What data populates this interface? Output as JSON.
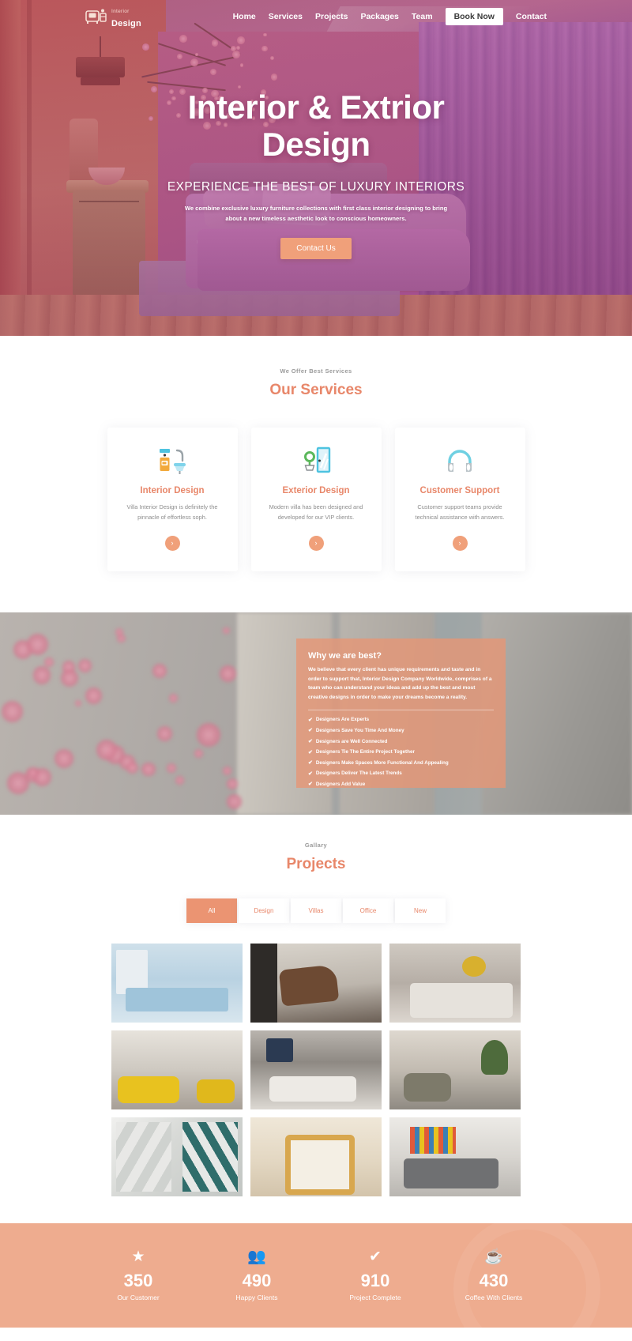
{
  "nav": {
    "logo_top": "Interior",
    "logo_bottom": "Design",
    "logo_icon": "armchair-icon",
    "links": [
      {
        "label": "Home"
      },
      {
        "label": "Services"
      },
      {
        "label": "Projects"
      },
      {
        "label": "Packages"
      },
      {
        "label": "Team"
      }
    ],
    "cta_label": "Book Now",
    "contact_label": "Contact"
  },
  "hero": {
    "title_line1": "Interior & Extrior",
    "title_line2": "Design",
    "subtitle": "EXPERIENCE THE BEST OF LUXURY INTERIORS",
    "description": "We combine exclusive luxury furniture collections with first class interior designing to bring about a new timeless aesthetic look to conscious homeowners.",
    "button_label": "Contact Us",
    "accent_color": "#f0a07a"
  },
  "services": {
    "eyebrow": "We Offer Best Services",
    "title": "Our Services",
    "title_color": "#e8876a",
    "cards": [
      {
        "icon": "sink-faucet-icon",
        "title": "Interior Design",
        "desc": "Villa Interior Design is definitely the pinnacle of effortless soph.",
        "arrow": "›"
      },
      {
        "icon": "door-plant-icon",
        "title": "Exterior Design",
        "desc": "Modern villa has been designed and developed for our VIP clients.",
        "arrow": "›"
      },
      {
        "icon": "headphones-icon",
        "title": "Customer Support",
        "desc": "Customer support teams provide technical assistance with answers.",
        "arrow": "›"
      }
    ]
  },
  "why": {
    "heading": "Why we are best?",
    "paragraph": "We believe that every client has unique requirements and taste and in order to support that, Interior Design Company Worldwide, comprises of a team who can understand your ideas and add up the best and most creative designs in order to make your dreams become a reality.",
    "panel_color": "#e69675",
    "items": [
      {
        "tick": "✔",
        "label": "Designers Are Experts"
      },
      {
        "tick": "✔",
        "label": "Designers Save You Time And Money"
      },
      {
        "tick": "✔",
        "label": "Designers are Well Connected"
      },
      {
        "tick": "✔",
        "label": "Designers Tie The Entire Project Together"
      },
      {
        "tick": "✔",
        "label": "Designers Make Spaces More Functional And Appealing"
      },
      {
        "tick": "✔",
        "label": "Designers Deliver The Latest Trends"
      },
      {
        "tick": "✔",
        "label": "Designers Add Value"
      }
    ]
  },
  "projects": {
    "eyebrow": "Gallary",
    "title": "Projects",
    "filters": [
      {
        "label": "All",
        "active": true
      },
      {
        "label": "Design",
        "active": false
      },
      {
        "label": "Villas",
        "active": false
      },
      {
        "label": "Office",
        "active": false
      },
      {
        "label": "New",
        "active": false
      }
    ],
    "rows": [
      [
        {
          "name": "kitchen-island"
        },
        {
          "name": "lounge-chair"
        },
        {
          "name": "bedroom-grey"
        }
      ],
      [
        {
          "name": "yellow-sofa-room"
        },
        {
          "name": "living-room-fireplace"
        },
        {
          "name": "plant-lounge"
        }
      ],
      [
        {
          "name": "geometric-wall"
        },
        {
          "name": "wooden-armchair"
        },
        {
          "name": "grey-sofa-library"
        }
      ]
    ]
  },
  "stats": {
    "background": "#eeac8f",
    "items": [
      {
        "icon": "star-icon",
        "glyph": "★",
        "value": "350",
        "label": "Our Customer"
      },
      {
        "icon": "people-icon",
        "glyph": "👥",
        "value": "490",
        "label": "Happy Clients"
      },
      {
        "icon": "check-icon",
        "glyph": "✔",
        "value": "910",
        "label": "Project Complete"
      },
      {
        "icon": "coffee-cup-icon",
        "glyph": "☕",
        "value": "430",
        "label": "Coffee With Clients"
      }
    ]
  }
}
